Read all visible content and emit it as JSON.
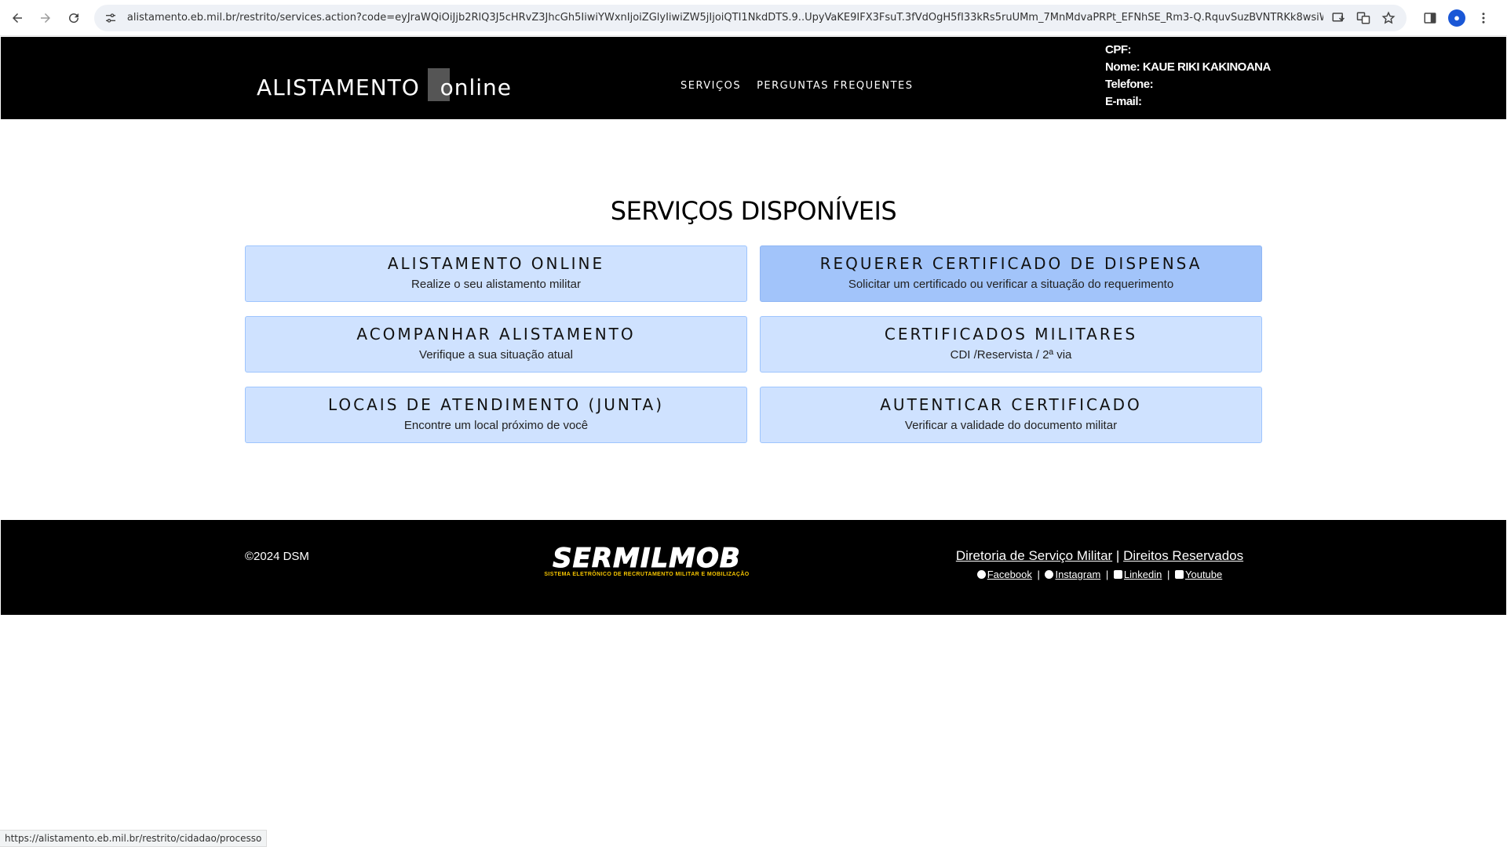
{
  "browser": {
    "url": "alistamento.eb.mil.br/restrito/services.action?code=eyJraWQiOiJjb2RlQ3J5cHRvZ3JhcGh5IiwiYWxnIjoiZGlyIiwiZW5jIjoiQTI1NkdDTS.9..UpyVaKE9IFX3FsuT.3fVdOgH5fI33kRs5ruUMm_7MnMdvaPRPt_EFNhSE_Rm3-Q.RquvSuzBVNTRKk8wsiWovw&state=...",
    "status_url": "https://alistamento.eb.mil.br/restrito/cidadao/processo"
  },
  "header": {
    "logo_main": "ALISTAMENTO",
    "logo_suffix": "online",
    "nav": [
      "SERVIÇOS",
      "PERGUNTAS FREQUENTES"
    ],
    "user": {
      "cpf_label": "CPF:",
      "cpf_value": "",
      "name_label": "Nome:",
      "name_value": "KAUE RIKI KAKINOANA",
      "phone_label": "Telefone:",
      "phone_value": "",
      "email_label": "E-mail:",
      "email_value": ""
    }
  },
  "main": {
    "title": "SERVIÇOS DISPONÍVEIS",
    "cards": [
      {
        "title": "ALISTAMENTO ONLINE",
        "subtitle": "Realize o seu alistamento militar"
      },
      {
        "title": "REQUERER CERTIFICADO DE DISPENSA",
        "subtitle": "Solicitar um certificado ou verificar a situação do requerimento"
      },
      {
        "title": "ACOMPANHAR ALISTAMENTO",
        "subtitle": "Verifique a sua situação atual"
      },
      {
        "title": "CERTIFICADOS MILITARES",
        "subtitle": "CDI /Reservista / 2ª via"
      },
      {
        "title": "LOCAIS DE ATENDIMENTO (JUNTA)",
        "subtitle": "Encontre um local próximo de você"
      },
      {
        "title": "AUTENTICAR CERTIFICADO",
        "subtitle": "Verificar a validade do documento militar"
      }
    ]
  },
  "footer": {
    "copyright": "©2024 DSM",
    "brand_main": "SERMILMOB",
    "brand_sub": "SISTEMA ELETRÔNICO DE RECRUTAMENTO MILITAR E MOBILIZAÇÃO",
    "link_dsm": "Diretoria de Serviço Militar",
    "separator": "|",
    "link_rights": "Direitos Reservados",
    "social": [
      "Facebook",
      "Instagram",
      "Linkedin",
      "Youtube"
    ]
  },
  "colors": {
    "card_bg": "#cfe2ff",
    "card_active_bg": "#a2c4fa",
    "header_bg": "#000000",
    "brand_sub": "#f5c400"
  }
}
